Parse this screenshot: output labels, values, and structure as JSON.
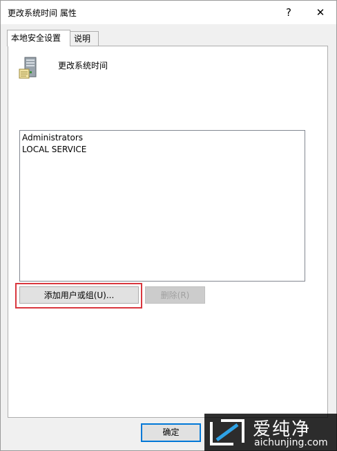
{
  "window": {
    "title": "更改系统时间 属性",
    "help_label": "?",
    "close_label": "✕"
  },
  "tabs": [
    {
      "label": "本地安全设置",
      "active": true
    },
    {
      "label": "说明",
      "active": false
    }
  ],
  "policy": {
    "icon": "server-computer-icon",
    "name": "更改系统时间"
  },
  "accounts": {
    "items": [
      "Administrators",
      "LOCAL SERVICE"
    ]
  },
  "buttons": {
    "add_label": "添加用户或组(U)...",
    "remove_label": "删除(R)",
    "ok_label": "确定"
  },
  "watermark": {
    "title": "爱纯净",
    "url": "aichunjing.com"
  },
  "colors": {
    "highlight": "#d9363e",
    "focus_border": "#0078d7"
  }
}
